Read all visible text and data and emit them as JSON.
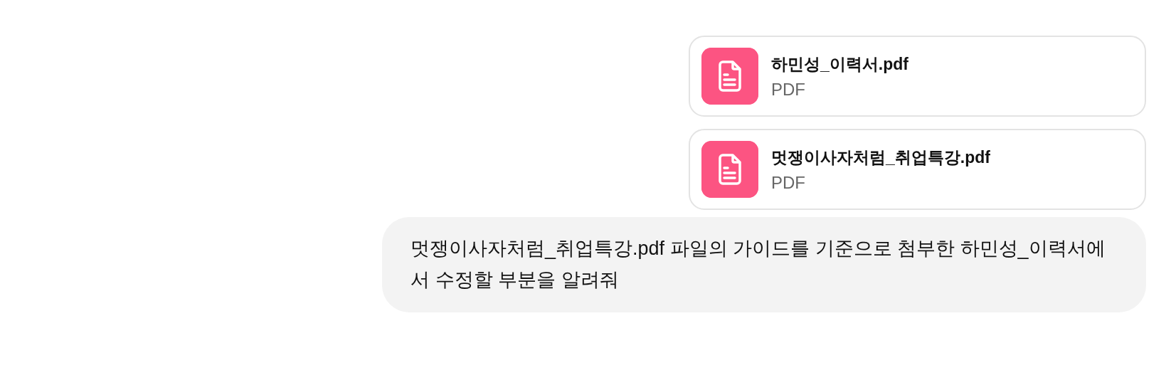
{
  "attachments": [
    {
      "name": "하민성_이력서.pdf",
      "type": "PDF"
    },
    {
      "name": "멋쟁이사자처럼_취업특강.pdf",
      "type": "PDF"
    }
  ],
  "message": {
    "text": "멋쟁이사자처럼_취업특강.pdf 파일의 가이드를 기준으로 첨부한 하민성_이력서에서 수정할 부분을 알려줘"
  }
}
